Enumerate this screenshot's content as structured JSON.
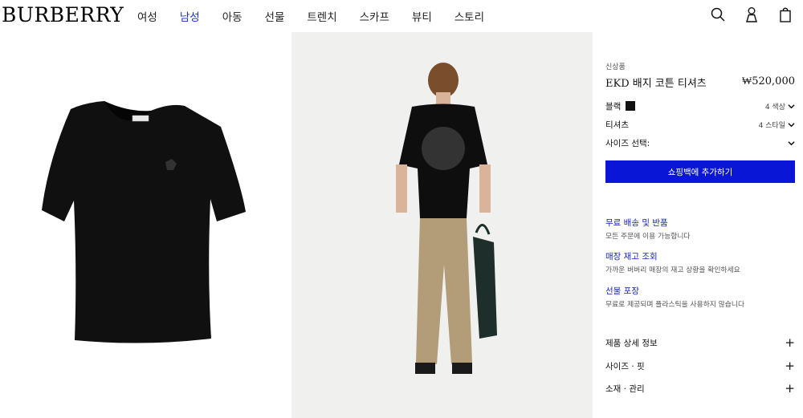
{
  "header": {
    "logo": "BURBERRY",
    "nav": [
      "여성",
      "남성",
      "아동",
      "선물",
      "트렌치",
      "스카프",
      "뷰티",
      "스토리"
    ],
    "active_nav": "남성",
    "icons": [
      "search-icon",
      "account-icon",
      "shopping-bag-icon"
    ]
  },
  "product": {
    "eyebrow": "신상품",
    "name": "EKD 배지 코튼 티셔츠",
    "price": "₩520,000",
    "color_label": "블랙",
    "color_swatch": "#111111",
    "color_count": "4 색상",
    "style_label": "티셔츠",
    "style_count": "4 스타일",
    "size_label": "사이즈 선택:",
    "cta": "쇼핑백에 추가하기",
    "cta_color": "#0a16d6"
  },
  "services": [
    {
      "title": "무료 배송 및 반품",
      "desc": "모든 주문에 이용 가능합니다"
    },
    {
      "title": "매장 재고 조회",
      "desc": "가까운 버버리 매장의 재고 상황을 확인하세요"
    },
    {
      "title": "선물 포장",
      "desc": "무료로 제공되며 플라스틱을 사용하지 않습니다"
    }
  ],
  "accordion": [
    {
      "label": "제품 상세 정보",
      "icon": "+"
    },
    {
      "label": "사이즈 · 핏",
      "icon": "+"
    },
    {
      "label": "소재 · 관리",
      "icon": "+"
    }
  ]
}
